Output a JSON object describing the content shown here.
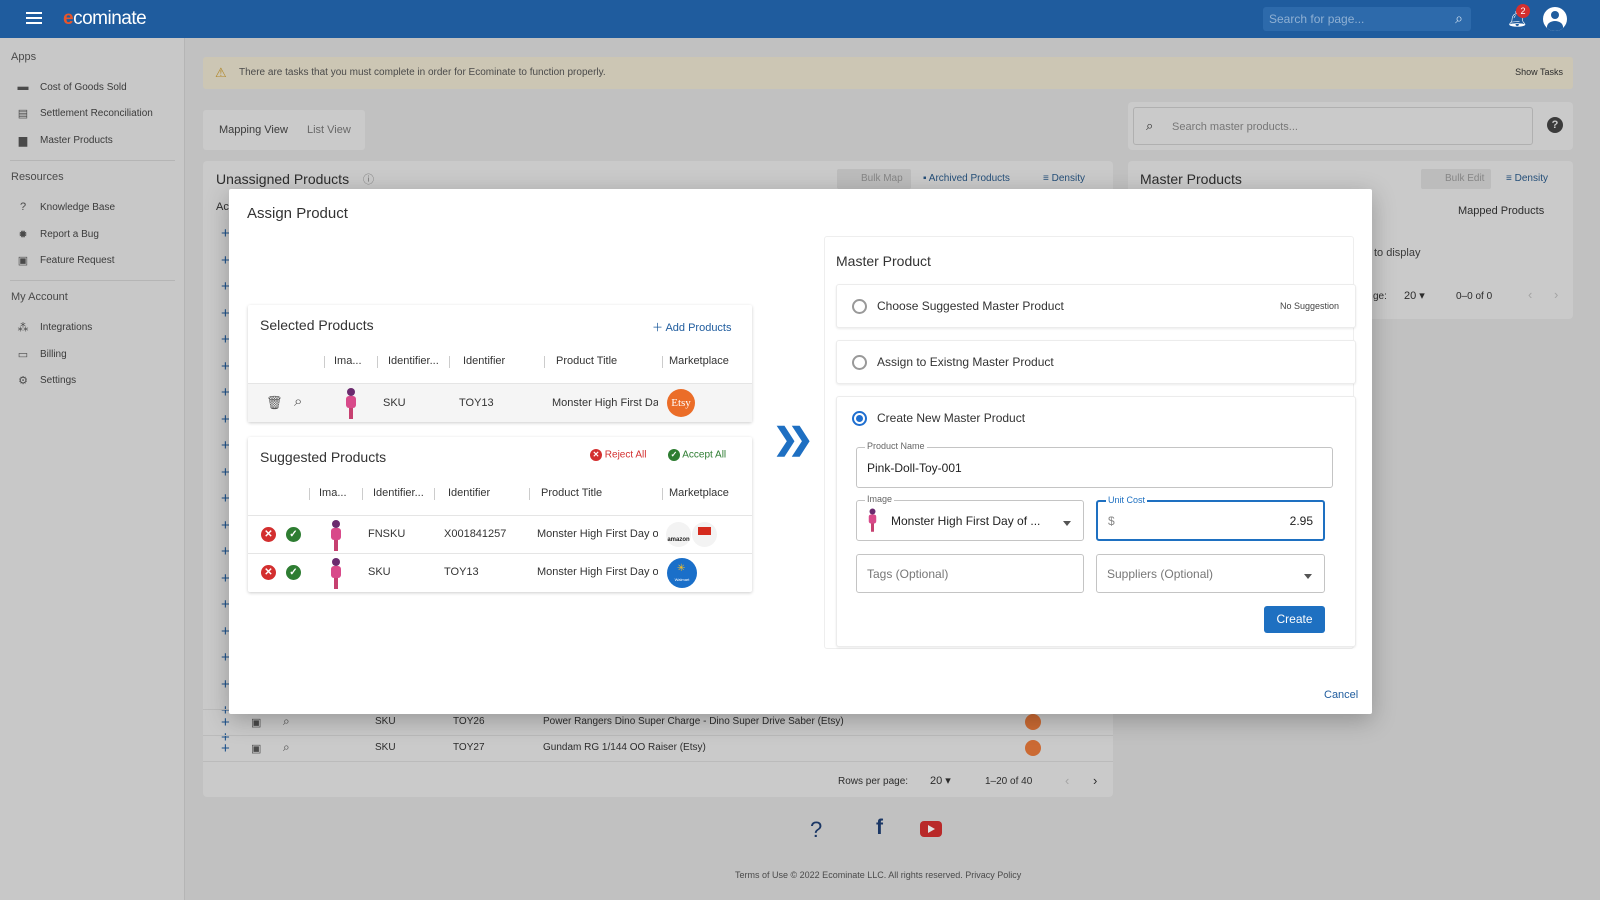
{
  "topbar": {
    "logo_e": "e",
    "logo_rest": "cominate",
    "search_placeholder": "Search for page...",
    "notification_count": "2"
  },
  "sidebar": {
    "apps_heading": "Apps",
    "apps": [
      "Cost of Goods Sold",
      "Settlement Reconciliation",
      "Master Products"
    ],
    "resources_heading": "Resources",
    "resources": [
      "Knowledge Base",
      "Report a Bug",
      "Feature Request"
    ],
    "account_heading": "My Account",
    "account": [
      "Integrations",
      "Billing",
      "Settings"
    ]
  },
  "alert": {
    "text": "There are tasks that you must complete in order for Ecominate to function properly.",
    "action": "Show Tasks"
  },
  "view_toggle": {
    "mapping": "Mapping View",
    "list": "List View"
  },
  "unassigned": {
    "title": "Unassigned Products",
    "bulk_map": "Bulk Map",
    "archived": "Archived Products",
    "density": "Density",
    "col_partial": "Ac",
    "rows": [
      {
        "type": "SKU",
        "id": "TOY26",
        "title": "Power Rangers Dino Super Charge - Dino Super Drive Saber (Etsy)"
      },
      {
        "type": "SKU",
        "id": "TOY27",
        "title": "Gundam RG 1/144 OO Raiser (Etsy)"
      }
    ],
    "rows_per_page_label": "Rows per page:",
    "rows_per_page": "20",
    "range": "1–20 of 40"
  },
  "master": {
    "search_placeholder": "Search master products...",
    "title": "Master Products",
    "bulk_edit": "Bulk Edit",
    "density": "Density",
    "col": "Mapped Products",
    "empty_partial": "to display",
    "rows_label_partial": "ge:",
    "rows_per_page": "20",
    "range": "0–0 of 0"
  },
  "modal": {
    "title": "Assign Product",
    "selected": {
      "title": "Selected Products",
      "add": "Add Products",
      "headers": [
        "Ima...",
        "Identifier...",
        "Identifier",
        "Product Title",
        "Marketplace"
      ],
      "rows": [
        {
          "type": "SKU",
          "id": "TOY13",
          "title": "Monster High First Day of School",
          "market": "Etsy"
        }
      ]
    },
    "suggested": {
      "title": "Suggested Products",
      "reject": "Reject All",
      "accept": "Accept All",
      "headers": [
        "Ima...",
        "Identifier...",
        "Identifier",
        "Product Title",
        "Marketplace"
      ],
      "rows": [
        {
          "type": "FNSKU",
          "id": "X001841257",
          "title": "Monster High First Day of School",
          "market": "amazon"
        },
        {
          "type": "SKU",
          "id": "TOY13",
          "title": "Monster High First Day of School",
          "market": "Walmart"
        }
      ]
    },
    "master_product": {
      "title": "Master Product",
      "opt1": "Choose Suggested Master Product",
      "opt1_note": "No Suggestion",
      "opt2": "Assign to Existng Master Product",
      "opt3": "Create New Master Product",
      "name_label": "Product Name",
      "name_value": "Pink-Doll-Toy-001",
      "image_label": "Image",
      "image_value": "Monster High First Day of ...",
      "cost_label": "Unit Cost",
      "cost_prefix": "$",
      "cost_value": "2.95",
      "tags_placeholder": "Tags (Optional)",
      "suppliers_placeholder": "Suppliers (Optional)",
      "create": "Create"
    },
    "cancel": "Cancel"
  },
  "footer": {
    "terms": "Terms of Use",
    "copyright": "© 2022 Ecominate LLC. All rights reserved.",
    "privacy": "Privacy Policy"
  }
}
